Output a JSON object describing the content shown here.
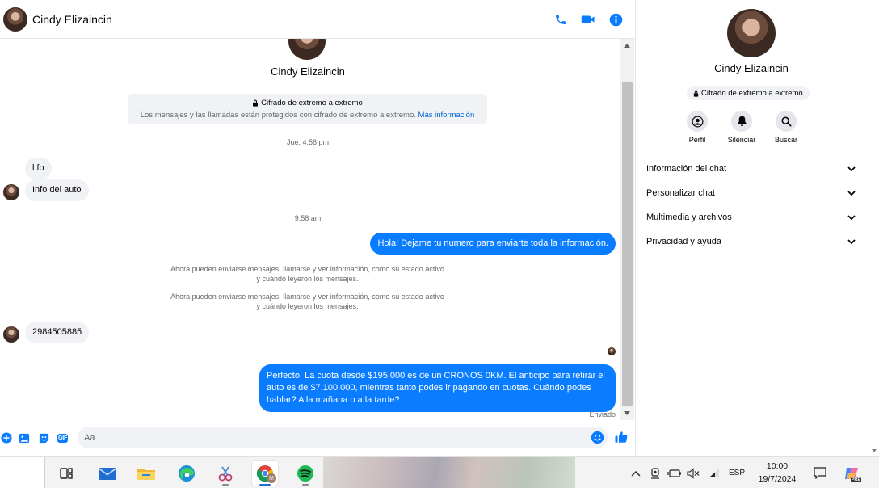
{
  "contact": {
    "name": "Cindy Elizaincin"
  },
  "header": {
    "icons": [
      "phone-icon",
      "video-camera-icon",
      "info-icon"
    ],
    "colors": {
      "accent": "#0a7cff"
    }
  },
  "encryption": {
    "title": "Cifrado de extremo a extremo",
    "description": "Los mensajes y las llamadas están protegidos con cifrado de extremo a extremo.",
    "link": "Más información"
  },
  "conversation": {
    "timestamp_1": "Jue, 4:56 pm",
    "timestamp_2": "9:58 am",
    "incoming_1": "l fo",
    "incoming_2": "Info del auto",
    "outgoing_1": "Hola! Dejame tu numero  para enviarte toda la información.",
    "notice_1": "Ahora pueden enviarse mensajes, llamarse y ver información, como su estado activo y cuándo leyeron los mensajes.",
    "notice_2": "Ahora pueden enviarse mensajes, llamarse y ver información, como su estado activo y cuándo leyeron los mensajes.",
    "incoming_3": "2984505885",
    "outgoing_2": "Perfecto! La cuota desde $195.000 es de un CRONOS 0KM. El anticipo para retirar el auto es de $7.100.000, mientras tanto podes ir pagando en cuotas. Cuándo podes hablar? A la mañana o a la tarde?",
    "status": "Enviado"
  },
  "composer": {
    "placeholder": "Aa",
    "icons": [
      "plus-icon",
      "image-icon",
      "sticker-icon",
      "gif-icon",
      "emoji-icon",
      "thumbs-up-icon"
    ],
    "gif_label": "GIF"
  },
  "info_panel": {
    "name": "Cindy Elizaincin",
    "badge": "Cifrado de extremo a extremo",
    "actions": [
      {
        "label": "Perfil",
        "icon": "profile-icon"
      },
      {
        "label": "Silenciar",
        "icon": "bell-icon"
      },
      {
        "label": "Buscar",
        "icon": "search-icon"
      }
    ],
    "sections": [
      {
        "label": "Información del chat"
      },
      {
        "label": "Personalizar chat"
      },
      {
        "label": "Multimedia y archivos"
      },
      {
        "label": "Privacidad y ayuda"
      }
    ]
  },
  "taskbar": {
    "apps": [
      "task-view-icon",
      "mail-icon",
      "file-explorer-icon",
      "edge-icon",
      "snipping-tool-icon",
      "chrome-icon",
      "spotify-icon"
    ],
    "chrome_badge": "M",
    "language": "ESP",
    "time": "10:00",
    "date": "19/7/2024",
    "copilot_badge": "PRE"
  }
}
